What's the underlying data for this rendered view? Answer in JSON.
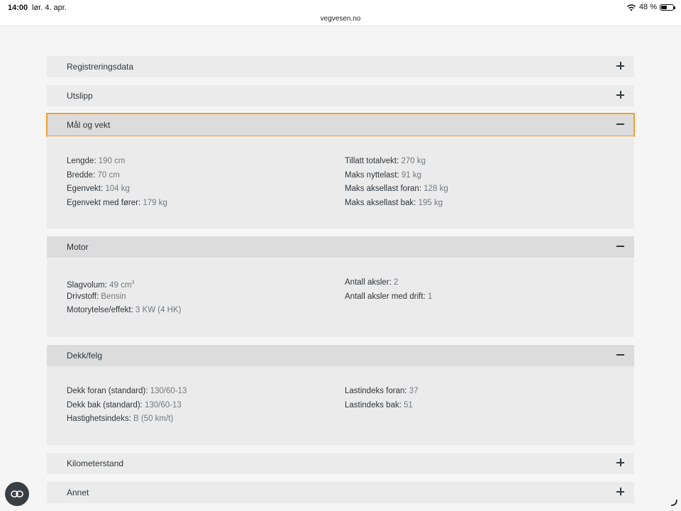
{
  "statusbar": {
    "time": "14:00",
    "date": "lør. 4. apr.",
    "url": "vegvesen.no",
    "battery_text": "48 %",
    "battery_level": 0.48
  },
  "colors": {
    "focus_outline": "#f0a030",
    "panel_bg": "#ebebeb",
    "panel_header_open": "#dcdcdc",
    "label": "#2f363c",
    "value": "#727a80"
  },
  "sections": {
    "registrering": {
      "title": "Registreringsdata",
      "state": "collapsed"
    },
    "utslipp": {
      "title": "Utslipp",
      "state": "collapsed"
    },
    "maal": {
      "title": "Mål og vekt",
      "state": "expanded",
      "left": [
        {
          "label": "Lengde:",
          "value": "190 cm"
        },
        {
          "label": "Bredde:",
          "value": "70 cm"
        },
        {
          "label": "Egenvekt:",
          "value": "104 kg"
        },
        {
          "label": "Egenvekt med fører:",
          "value": "179 kg"
        }
      ],
      "right": [
        {
          "label": "Tillatt totalvekt:",
          "value": "270 kg"
        },
        {
          "label": "Maks nyttelast:",
          "value": "91 kg"
        },
        {
          "label": "Maks aksellast foran:",
          "value": "128 kg"
        },
        {
          "label": "Maks aksellast bak:",
          "value": "195 kg"
        }
      ]
    },
    "motor": {
      "title": "Motor",
      "state": "expanded",
      "left": [
        {
          "label": "Slagvolum:",
          "value": "49 cm",
          "sup": "3"
        },
        {
          "label": "Drivstoff:",
          "value": "Bensin"
        },
        {
          "label": "Motorytelse/effekt:",
          "value": "3 KW (4 HK)"
        }
      ],
      "right": [
        {
          "label": "Antall aksler:",
          "value": "2"
        },
        {
          "label": "Antall aksler med drift:",
          "value": "1"
        }
      ]
    },
    "dekk": {
      "title": "Dekk/felg",
      "state": "expanded",
      "left": [
        {
          "label": "Dekk foran (standard):",
          "value": "130/60-13"
        },
        {
          "label": "Dekk bak (standard):",
          "value": "130/60-13"
        },
        {
          "label": "Hastighetsindeks:",
          "value": "B (50 km/t)"
        }
      ],
      "right": [
        {
          "label": "Lastindeks foran:",
          "value": "37"
        },
        {
          "label": "Lastindeks bak:",
          "value": "51"
        }
      ]
    },
    "km": {
      "title": "Kilometerstand",
      "state": "collapsed"
    },
    "annet": {
      "title": "Annet",
      "state": "collapsed"
    }
  }
}
